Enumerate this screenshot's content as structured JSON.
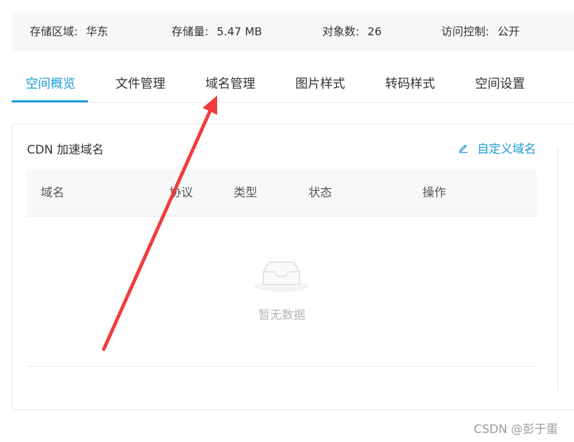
{
  "info_bar": {
    "region_label": "存储区域:",
    "region_value": "华东",
    "storage_label": "存储量:",
    "storage_value": "5.47 MB",
    "objects_label": "对象数:",
    "objects_value": "26",
    "access_label": "访问控制:",
    "access_value": "公开"
  },
  "tabs": [
    {
      "label": "空间概览",
      "active": true
    },
    {
      "label": "文件管理",
      "active": false
    },
    {
      "label": "域名管理",
      "active": false
    },
    {
      "label": "图片样式",
      "active": false
    },
    {
      "label": "转码样式",
      "active": false
    },
    {
      "label": "空间设置",
      "active": false
    }
  ],
  "cdn_panel": {
    "title": "CDN 加速域名",
    "custom_domain_label": "自定义域名",
    "custom_domain_icon": "edit-pencil-icon",
    "columns": [
      "域名",
      "协议",
      "类型",
      "状态",
      "操作"
    ],
    "empty_text": "暂无数据",
    "empty_icon": "empty-inbox-icon"
  },
  "watermark": "CSDN @彭于蛋",
  "colors": {
    "accent": "#1a9bd7",
    "annotation_arrow": "#f03c3c",
    "info_bg": "#f6f7f8"
  }
}
